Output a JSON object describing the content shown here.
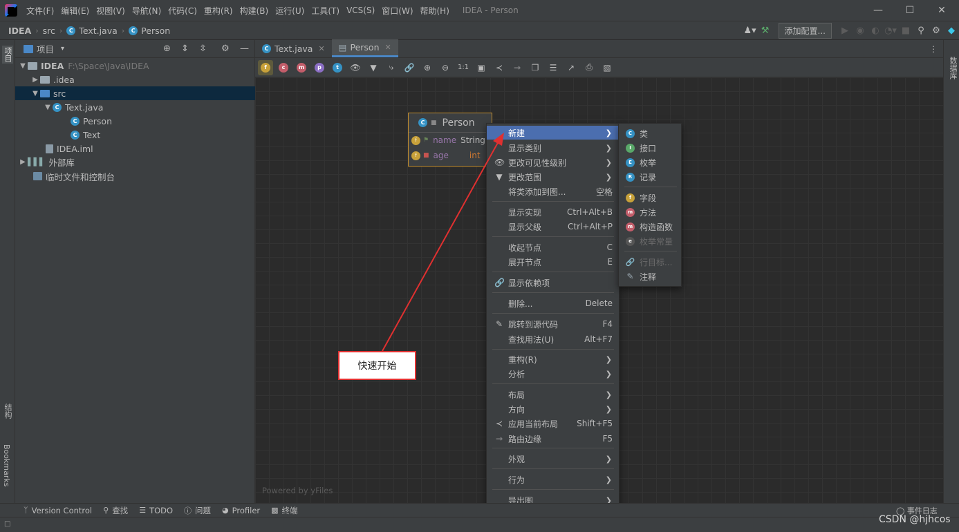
{
  "app": {
    "window_title": "IDEA - Person"
  },
  "menubar": [
    "文件(F)",
    "编辑(E)",
    "视图(V)",
    "导航(N)",
    "代码(C)",
    "重构(R)",
    "构建(B)",
    "运行(U)",
    "工具(T)",
    "VCS(S)",
    "窗口(W)",
    "帮助(H)"
  ],
  "breadcrumb": {
    "project": "IDEA",
    "folder": "src",
    "file": "Text.java",
    "class": "Person"
  },
  "toolbar": {
    "run_config": "添加配置..."
  },
  "left_stripe": {
    "project": "项目",
    "structure": "结构",
    "bookmarks": "Bookmarks"
  },
  "right_stripe": {
    "database": "数据库"
  },
  "project_panel": {
    "title": "项目",
    "tree": [
      {
        "label": "IDEA",
        "path": "F:\\Space\\Java\\IDEA"
      },
      {
        "label": ".idea"
      },
      {
        "label": "src"
      },
      {
        "label": "Text.java"
      },
      {
        "label": "Person"
      },
      {
        "label": "Text"
      },
      {
        "label": "IDEA.iml"
      },
      {
        "label": "外部库"
      },
      {
        "label": "临时文件和控制台"
      }
    ]
  },
  "editor_tabs": [
    {
      "label": "Text.java"
    },
    {
      "label": "Person"
    }
  ],
  "uml_class": {
    "name": "Person",
    "fields": [
      {
        "name": "name",
        "type": "String"
      },
      {
        "name": "age",
        "type": "int"
      }
    ]
  },
  "context_menu": [
    {
      "label": "新建",
      "shortcut": "",
      "submenu": true
    },
    {
      "label": "显示类别",
      "shortcut": "",
      "submenu": true
    },
    {
      "label": "更改可见性级别",
      "shortcut": "",
      "submenu": true
    },
    {
      "label": "更改范围",
      "shortcut": "",
      "submenu": true
    },
    {
      "label": "将类添加到图...",
      "shortcut": "空格"
    },
    {
      "label": "显示实现",
      "shortcut": "Ctrl+Alt+B"
    },
    {
      "label": "显示父级",
      "shortcut": "Ctrl+Alt+P"
    },
    {
      "label": "收起节点",
      "shortcut": "C"
    },
    {
      "label": "展开节点",
      "shortcut": "E"
    },
    {
      "label": "显示依赖项",
      "shortcut": ""
    },
    {
      "label": "删除...",
      "shortcut": "Delete"
    },
    {
      "label": "跳转到源代码",
      "shortcut": "F4"
    },
    {
      "label": "查找用法(U)",
      "shortcut": "Alt+F7"
    },
    {
      "label": "重构(R)",
      "shortcut": "",
      "submenu": true
    },
    {
      "label": "分析",
      "shortcut": "",
      "submenu": true
    },
    {
      "label": "布局",
      "shortcut": "",
      "submenu": true
    },
    {
      "label": "方向",
      "shortcut": "",
      "submenu": true
    },
    {
      "label": "应用当前布局",
      "shortcut": "Shift+F5"
    },
    {
      "label": "路由边缘",
      "shortcut": "F5"
    },
    {
      "label": "外观",
      "shortcut": "",
      "submenu": true
    },
    {
      "label": "行为",
      "shortcut": "",
      "submenu": true
    },
    {
      "label": "导出图",
      "shortcut": "",
      "submenu": true
    }
  ],
  "submenu": [
    {
      "label": "类",
      "badge": "C"
    },
    {
      "label": "接口",
      "badge": "I"
    },
    {
      "label": "枚举",
      "badge": "E"
    },
    {
      "label": "记录",
      "badge": "R"
    },
    {
      "label": "字段",
      "badge": "f"
    },
    {
      "label": "方法",
      "badge": "m"
    },
    {
      "label": "构造函数",
      "badge": "m"
    },
    {
      "label": "枚举常量",
      "badge": "e"
    },
    {
      "label": "行目标...",
      "badge": ""
    },
    {
      "label": "注释",
      "badge": ""
    }
  ],
  "callout": {
    "text": "快速开始"
  },
  "canvas": {
    "powered_by": "Powered by yFiles"
  },
  "statusbar": [
    {
      "label": "Version Control",
      "icon": "branch-icon"
    },
    {
      "label": "查找",
      "icon": "search-icon"
    },
    {
      "label": "TODO",
      "icon": "list-icon"
    },
    {
      "label": "问题",
      "icon": "info-icon"
    },
    {
      "label": "Profiler",
      "icon": "profiler-icon"
    },
    {
      "label": "终端",
      "icon": "terminal-icon"
    }
  ],
  "event_log": "事件日志",
  "watermark": "CSDN @hjhcos",
  "colors": {
    "accent": "#4b6eaf",
    "callout_border": "#e03030",
    "uml_border": "#c38e2d",
    "class_icon": "#3592c4"
  }
}
